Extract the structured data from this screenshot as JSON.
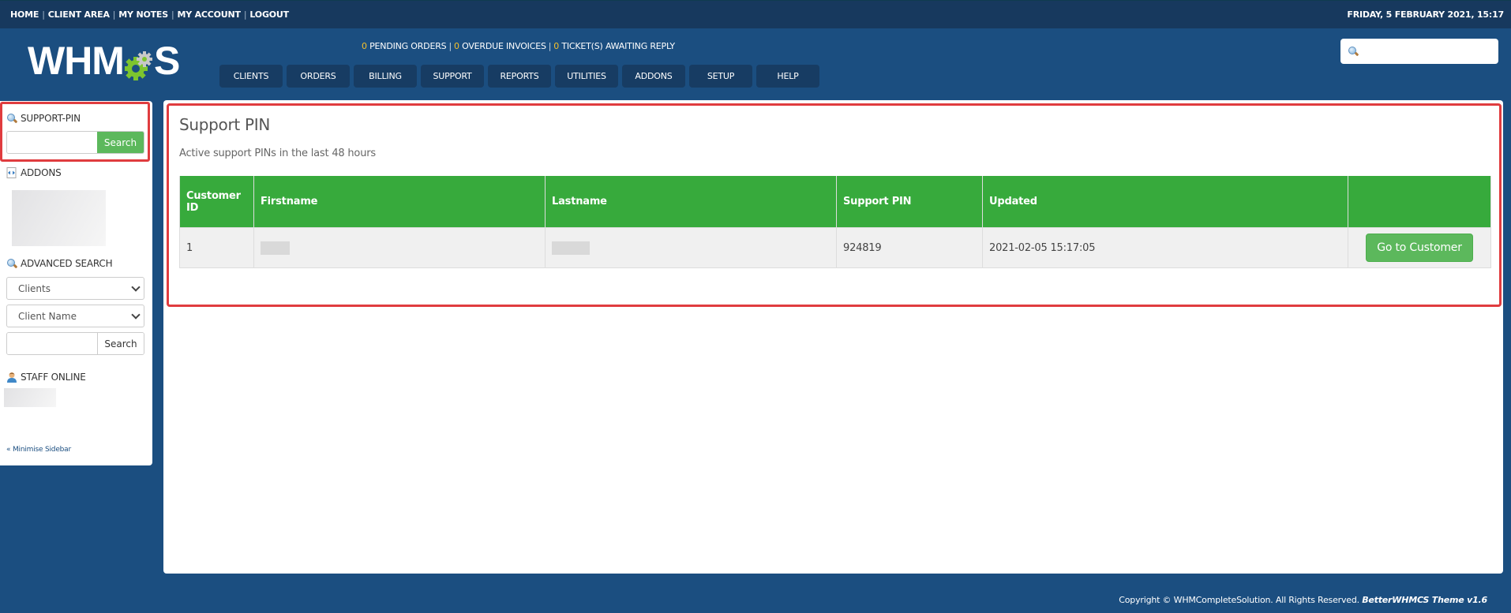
{
  "topbar": {
    "links": [
      "HOME",
      "CLIENT AREA",
      "MY NOTES",
      "MY ACCOUNT",
      "LOGOUT"
    ],
    "datetime": "FRIDAY, 5 FEBRUARY 2021, 15:17"
  },
  "header": {
    "logo": {
      "prefix": "WHM",
      "suffix": "S"
    },
    "stats": [
      {
        "count": "0",
        "label": "PENDING ORDERS"
      },
      {
        "count": "0",
        "label": "OVERDUE INVOICES"
      },
      {
        "count": "0",
        "label": "TICKET(S) AWAITING REPLY"
      }
    ],
    "nav": [
      "CLIENTS",
      "ORDERS",
      "BILLING",
      "SUPPORT",
      "REPORTS",
      "UTILITIES",
      "ADDONS",
      "SETUP",
      "HELP"
    ],
    "search": {
      "value": "",
      "placeholder": ""
    }
  },
  "sidebar": {
    "support_pin": {
      "title": "SUPPORT-PIN",
      "value": "",
      "button": "Search"
    },
    "addons": {
      "title": "ADDONS"
    },
    "advanced_search": {
      "title": "ADVANCED SEARCH",
      "type_select": "Clients",
      "field_select": "Client Name",
      "value": "",
      "button": "Search"
    },
    "staff_online": {
      "title": "STAFF ONLINE"
    },
    "minimise": "« Minimise Sidebar"
  },
  "main": {
    "title": "Support PIN",
    "description": "Active support PINs in the last 48 hours",
    "table": {
      "headers": [
        "Customer ID",
        "Firstname",
        "Lastname",
        "Support PIN",
        "Updated",
        ""
      ],
      "rows": [
        {
          "customer_id": "1",
          "firstname": "",
          "lastname": "",
          "pin": "924819",
          "updated": "2021-02-05 15:17:05",
          "action": "Go to Customer"
        }
      ]
    }
  },
  "footer": {
    "copyright": "Copyright © WHMCompleteSolution. All Rights Reserved.",
    "theme": "BetterWHMCS Theme v1.6"
  },
  "colors": {
    "background": "#1b4e80",
    "topbar": "#17395e",
    "nav_button": "#173c63",
    "accent_yellow": "#f5c02a",
    "table_header": "#37aa3c",
    "button_green": "#5cb85c",
    "highlight_red": "#e03c3f"
  }
}
